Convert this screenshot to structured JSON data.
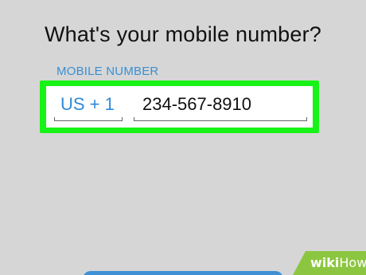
{
  "screen": {
    "heading": "What's your mobile number?"
  },
  "phone_field": {
    "label": "MOBILE NUMBER",
    "country_code": "US + 1",
    "value": "234-567-8910"
  },
  "watermark": {
    "wiki": "wiki",
    "how": "How"
  },
  "colors": {
    "background": "#d6d6d6",
    "accent_blue": "#3a8fd2",
    "highlight_green": "#17f317",
    "watermark_green": "#8cc640"
  }
}
